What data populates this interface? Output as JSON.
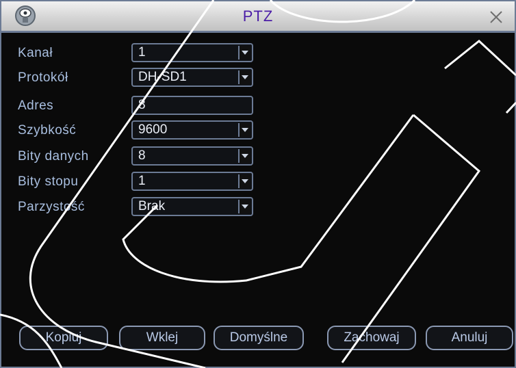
{
  "window": {
    "title": "PTZ"
  },
  "icons": {
    "app": "camera-logo-icon",
    "close": "close-icon",
    "dropdown": "chevron-down-icon"
  },
  "fields": [
    {
      "label": "Kanał",
      "value": "1",
      "type": "select"
    },
    {
      "label": "Protokół",
      "value": "DH-SD1",
      "type": "select"
    },
    {
      "label": "Adres",
      "value": "8",
      "type": "text"
    },
    {
      "label": "Szybkość",
      "value": "9600",
      "type": "select"
    },
    {
      "label": "Bity danych",
      "value": "8",
      "type": "select"
    },
    {
      "label": "Bity stopu",
      "value": "1",
      "type": "select"
    },
    {
      "label": "Parzystość",
      "value": "Brak",
      "type": "select"
    }
  ],
  "buttons": {
    "copy": "Kopiuj",
    "paste": "Wklej",
    "defaults": "Domyślne",
    "save": "Zachowaj",
    "cancel": "Anuluj"
  },
  "colors": {
    "border": "#6c7b95",
    "label": "#a9bfe0",
    "title": "#4a1ca6",
    "background": "#0a0a0a"
  }
}
